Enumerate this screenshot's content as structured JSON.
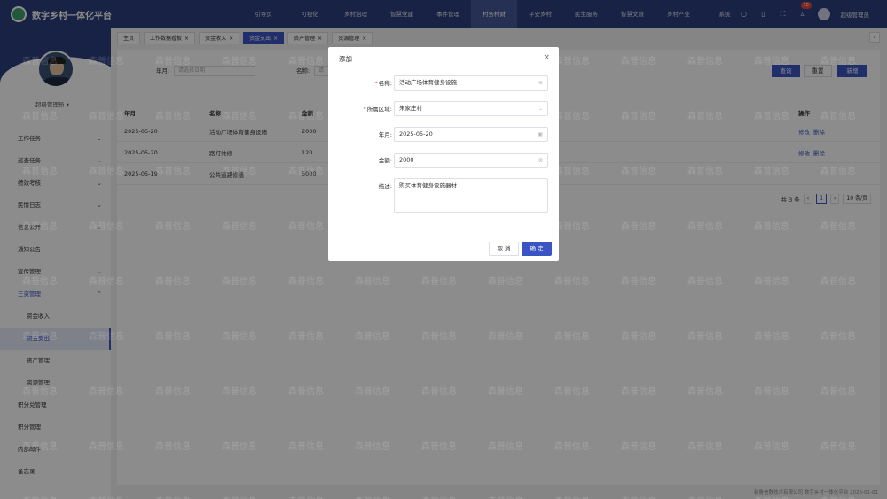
{
  "app": {
    "title": "数字乡村一体化平台"
  },
  "nav": [
    "引导页",
    "可视化",
    "乡村治理",
    "智慧党建",
    "事件管理",
    "村务村财",
    "平安乡村",
    "民生服务",
    "智慧文旅",
    "乡村产业",
    "系统"
  ],
  "header": {
    "badge": "10",
    "user": "超级管理员"
  },
  "sidebar": {
    "user": "超级管理员",
    "items": [
      {
        "label": "工作任务",
        "has_children": true
      },
      {
        "label": "巡查任务",
        "has_children": true
      },
      {
        "label": "绩效考核",
        "has_children": true
      },
      {
        "label": "民情日志",
        "has_children": true
      },
      {
        "label": "信息公开",
        "has_children": true
      },
      {
        "label": "通知公告",
        "has_children": false
      },
      {
        "label": "宣传管理",
        "has_children": true
      },
      {
        "label": "三资管理",
        "has_children": true,
        "open": true
      }
    ],
    "subitems": [
      "资金收入",
      "资金支出",
      "资产管理",
      "资源管理"
    ],
    "items2": [
      "积分兑管理",
      "积分管理",
      "内部邮件",
      "备忘录"
    ]
  },
  "tabs": [
    "主页",
    "工作数据看板",
    "资金收入",
    "资金支出",
    "资产管理",
    "资源管理"
  ],
  "search": {
    "date_label": "年月:",
    "date_placeholder": "请选择日期",
    "name_label": "名称:",
    "name_placeholder": "请"
  },
  "actions": {
    "search": "查询",
    "reset": "重置",
    "add": "新增"
  },
  "table": {
    "headers": [
      "年月",
      "名称",
      "金额",
      "操作"
    ],
    "rows": [
      {
        "month": "2025-05-20",
        "name": "活动广场体育健身设施",
        "amount": "2000"
      },
      {
        "month": "2025-05-20",
        "name": "路灯维修",
        "amount": "120"
      },
      {
        "month": "2025-05-19",
        "name": "公共道路修缮",
        "amount": "5000"
      }
    ],
    "edit": "修改",
    "delete": "删除"
  },
  "pager": {
    "total": "共 3 条",
    "page": "1",
    "size": "10 条/页"
  },
  "footer": "新鲁信数技术有限公司  数字乡村一体化平台  2026-01-01",
  "watermark": "森普信息",
  "modal": {
    "title": "添加",
    "fields": [
      {
        "label": "名称:",
        "required": true,
        "value": "活动广场体育健身设施",
        "icon": "clear-icon"
      },
      {
        "label": "所属区域:",
        "required": true,
        "value": "朱家庄村",
        "icon": "chevron-down-icon"
      },
      {
        "label": "年月:",
        "required": false,
        "value": "2025-05-20",
        "icon": "calendar-icon"
      },
      {
        "label": "金额:",
        "required": false,
        "value": "2000",
        "icon": "clear-icon"
      },
      {
        "label": "描述:",
        "required": false,
        "value": "购买体育健身设施器材"
      }
    ],
    "cancel": "取 消",
    "confirm": "确 定"
  },
  "colors": {
    "brand": "#2c3e7d",
    "accent": "#3b54c4",
    "danger": "#e5483b"
  }
}
